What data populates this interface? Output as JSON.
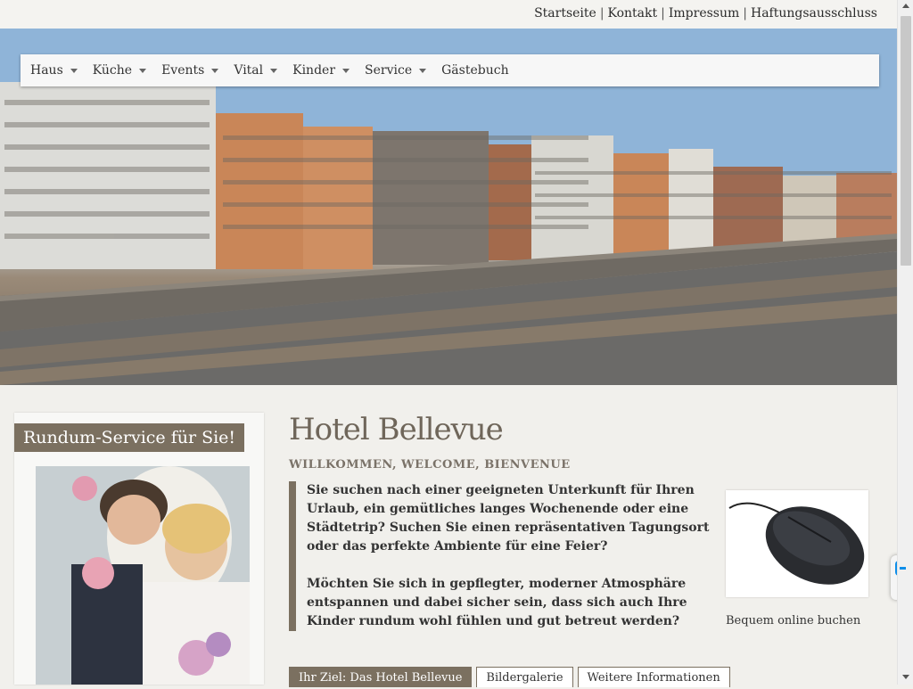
{
  "top_links": [
    "Startseite",
    "Kontakt",
    "Impressum",
    "Haftungsausschluss"
  ],
  "nav": [
    {
      "label": "Haus",
      "dropdown": true
    },
    {
      "label": "Küche",
      "dropdown": true
    },
    {
      "label": "Events",
      "dropdown": true
    },
    {
      "label": "Vital",
      "dropdown": true
    },
    {
      "label": "Kinder",
      "dropdown": true
    },
    {
      "label": "Service",
      "dropdown": true
    },
    {
      "label": "Gästebuch",
      "dropdown": false
    }
  ],
  "sidebar": {
    "title": "Rundum-Service für Sie!"
  },
  "main": {
    "title": "Hotel Bellevue",
    "subtitle": "WILLKOMMEN, WELCOME, BIENVENUE",
    "intro_p1": "Sie suchen nach einer geeigneten Unterkunft für Ihren Urlaub, ein gemütliches langes Wochenende oder eine Städtetrip? Suchen Sie einen repräsentativen Tagungsort oder das perfekte Ambiente für eine Feier?",
    "intro_p2": "Möchten Sie sich in gepflegter, moderner Atmosphäre entspannen und dabei sicher sein, dass sich auch Ihre Kinder rundum wohl fühlen und gut betreut werden?",
    "promo_caption": "Bequem online buchen",
    "tabs": [
      "Ihr Ziel: Das Hotel Bellevue",
      "Bildergalerie",
      "Weitere Informationen"
    ]
  },
  "colors": {
    "accent": "#7b7060",
    "page_bg": "#f1f0ec"
  }
}
